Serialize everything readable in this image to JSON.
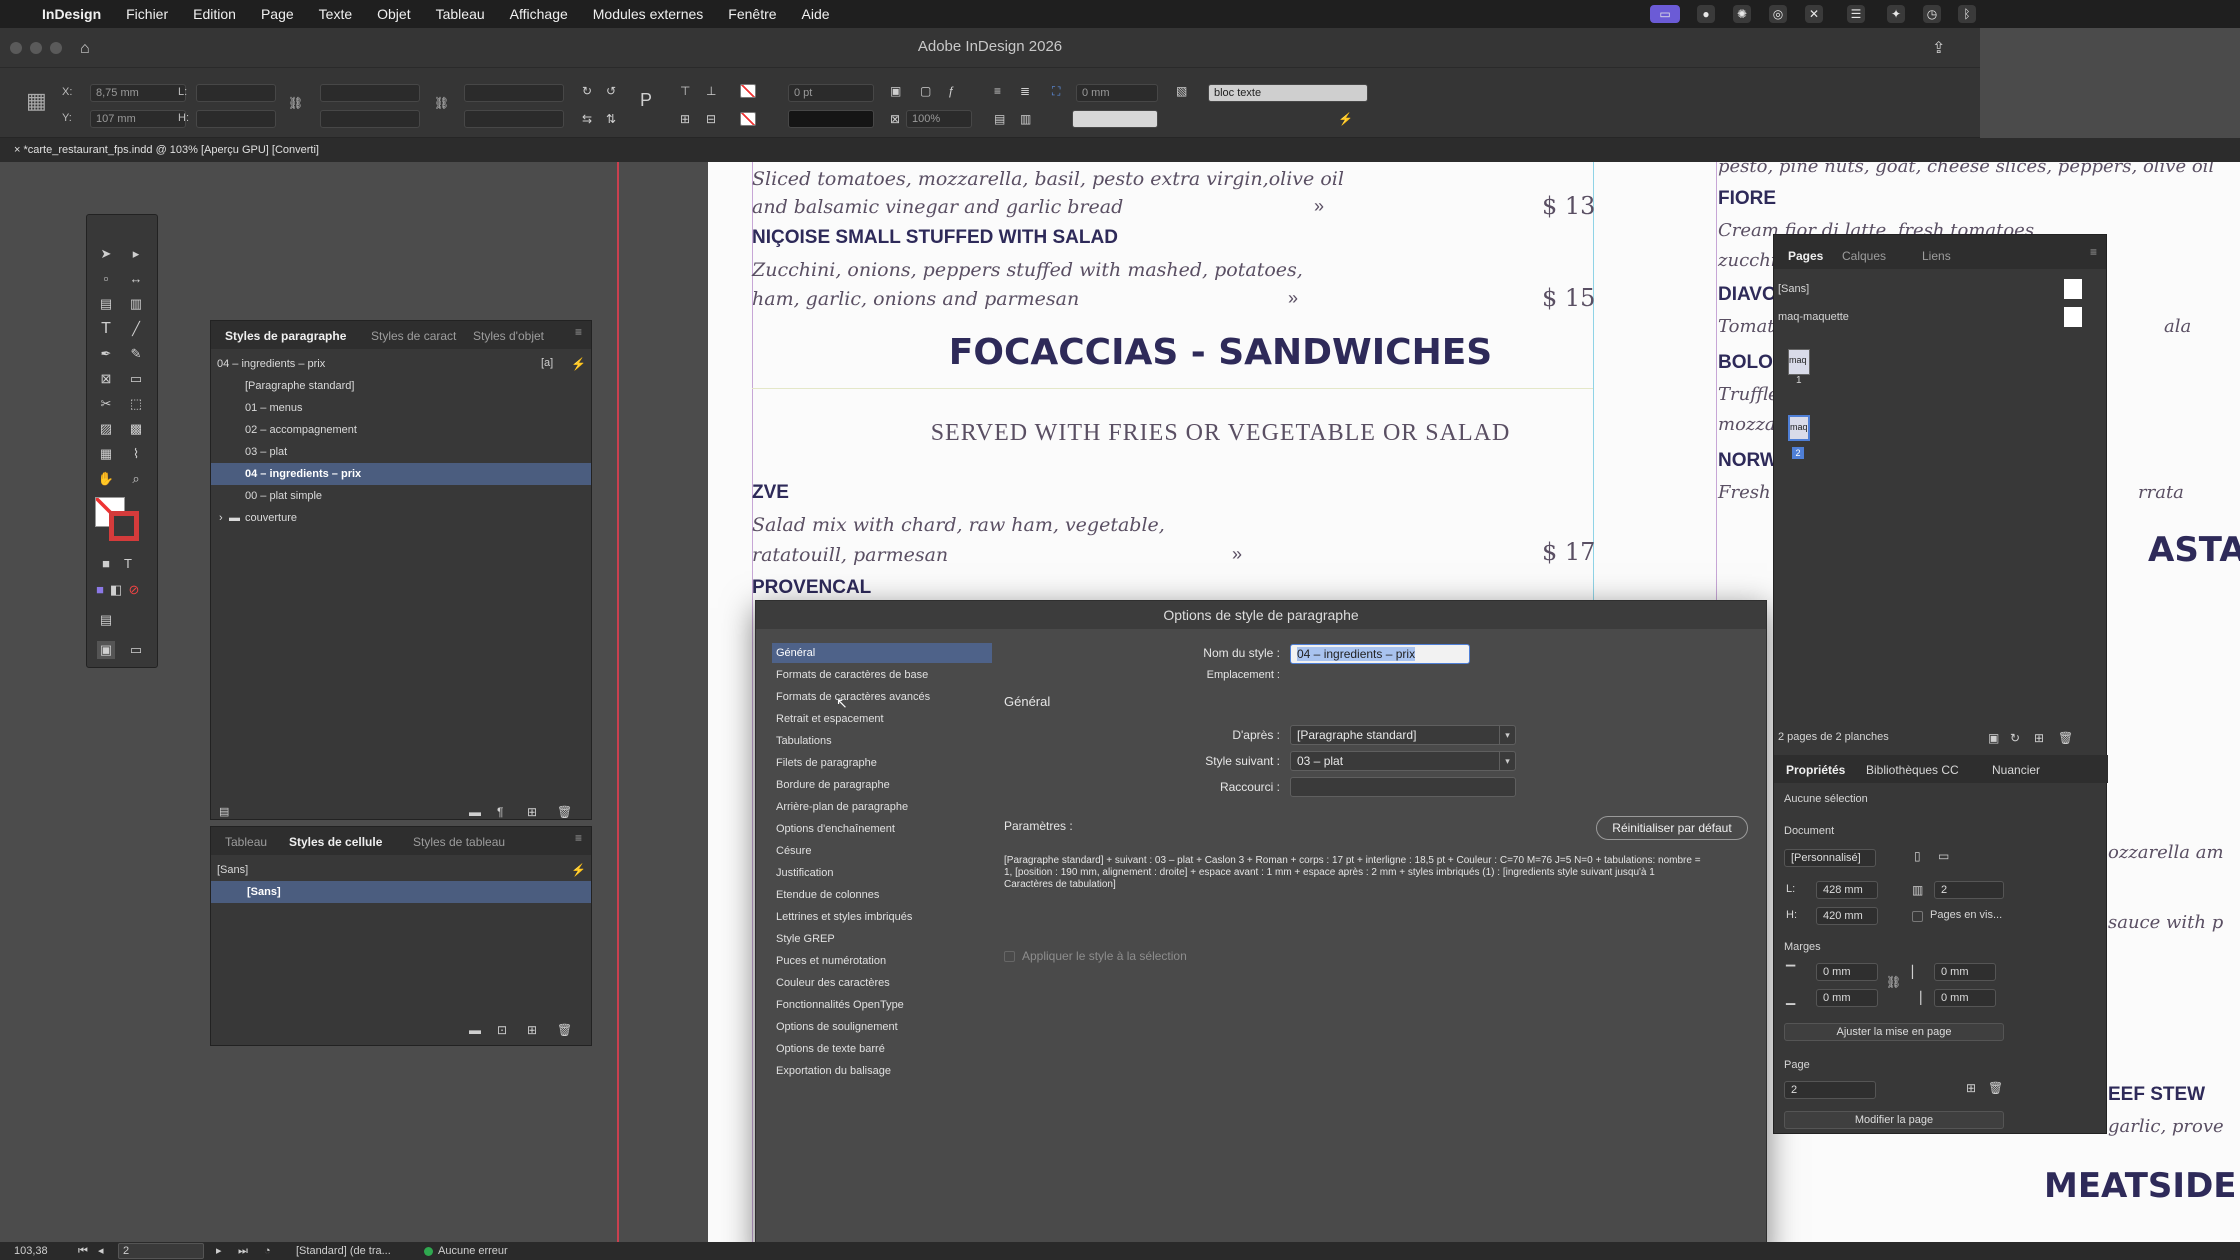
{
  "menubar": {
    "app": "InDesign",
    "items": [
      "Fichier",
      "Edition",
      "Page",
      "Texte",
      "Objet",
      "Tableau",
      "Affichage",
      "Modules externes",
      "Fenêtre",
      "Aide"
    ]
  },
  "window": {
    "title": "Adobe InDesign 2026",
    "doc_tab": "*carte_restaurant_fps.indd @ 103% [Aperçu GPU] [Converti]"
  },
  "control": {
    "x_label": "X:",
    "x_value": "8,75 mm",
    "y_label": "Y:",
    "y_value": "107 mm",
    "w_label": "L:",
    "h_label": "H:",
    "stroke_value": "0 pt",
    "scale_value": "100%",
    "offset_value": "0 mm",
    "object_style": "bloc texte"
  },
  "menu_page": {
    "line1": "Sliced tomatoes, mozzarella, basil, pesto extra virgin,olive oil",
    "line2": "and balsamic vinegar and garlic bread",
    "price1": "$ 13",
    "nicoise": "NIÇOISE SMALL STUFFED WITH SALAD",
    "line3": "Zucchini, onions, peppers stuffed with mashed, potatoes,",
    "line4": "ham, garlic, onions and parmesan",
    "price2": "$ 15",
    "section": "FOCACCIAS - SANDWICHES",
    "subsection": "SERVED WITH FRIES OR VEGETABLE OR SALAD",
    "zve": "ZVE",
    "line5": "Salad mix with chard, raw ham, vegetable,",
    "line6": "ratatouill, parmesan",
    "price3": "$ 17",
    "provencal": "PROVENCAL",
    "right_top": "pesto, pine nuts, goat, cheese slices, peppers, olive oil",
    "fiore": "FIORE",
    "fiore_desc": "Cream fior di latte, fresh tomatoes,",
    "zucchi": "zucchi",
    "diavo": "DIAVO",
    "tomat": "Tomat",
    "ala": "ala",
    "bolo": "BOLO",
    "truffle": "Truffle",
    "mozza": "mozza",
    "norw": "NORW",
    "fresh": "Fresh",
    "rrata": "rrata",
    "asta": "ASTA",
    "mozzarella_am": "ozzarella am",
    "sauce_with": "sauce with p",
    "eef_stew": "EEF STEW",
    "garlic_prove": "garlic, prove",
    "meatside": "MEATSIDE"
  },
  "para_styles_panel": {
    "tabs": [
      "Styles de paragraphe",
      "Styles de caract",
      "Styles d'objet"
    ],
    "current": "04 – ingredients – prix",
    "items": [
      "[Paragraphe standard]",
      "01 – menus",
      "02 – accompagnement",
      "03 – plat",
      "04 – ingredients – prix",
      "00 – plat simple",
      "couverture"
    ]
  },
  "cell_styles_panel": {
    "tabs": [
      "Tableau",
      "Styles de cellule",
      "Styles de tableau"
    ],
    "current": "[Sans]",
    "items": [
      "[Sans]"
    ]
  },
  "dialog": {
    "title": "Options de style de paragraphe",
    "categories": [
      "Général",
      "Formats de caractères de base",
      "Formats de caractères avancés",
      "Retrait et espacement",
      "Tabulations",
      "Filets de paragraphe",
      "Bordure de paragraphe",
      "Arrière-plan de paragraphe",
      "Options d'enchaînement",
      "Césure",
      "Justification",
      "Etendue de colonnes",
      "Lettrines et styles imbriqués",
      "Style GREP",
      "Puces et numérotation",
      "Couleur des caractères",
      "Fonctionnalités OpenType",
      "Options de soulignement",
      "Options de texte barré",
      "Exportation du balisage"
    ],
    "style_name_label": "Nom du style :",
    "style_name": "04 – ingredients – prix",
    "location_label": "Emplacement :",
    "section_title": "Général",
    "based_on_label": "D'après :",
    "based_on": "[Paragraphe standard]",
    "next_style_label": "Style suivant :",
    "next_style": "03 – plat",
    "shortcut_label": "Raccourci :",
    "params_label": "Paramètres :",
    "reset_button": "Réinitialiser par défaut",
    "params_text": "[Paragraphe standard] + suivant : 03 – plat + Caslon 3 + Roman + corps : 17 pt + interligne : 18,5 pt + Couleur : C=70 M=76 J=5 N=0 + tabulations: nombre = 1, [position : 190 mm, alignement : droite] + espace avant : 1 mm + espace après : 2 mm + styles imbriqués (1) : [ingredients style suivant jusqu'à 1 Caractères de tabulation]",
    "apply_label": "Appliquer le style à la sélection"
  },
  "pages_panel": {
    "tabs": [
      "Pages",
      "Calques",
      "Liens"
    ],
    "none_master": "[Sans]",
    "master": "maq-maquette",
    "page1_label": "maq",
    "page1_num": "1",
    "page2_label": "maq",
    "page2_num": "2",
    "footer": "2 pages de 2 planches"
  },
  "props_panel": {
    "tabs": [
      "Propriétés",
      "Bibliothèques CC",
      "Nuancier"
    ],
    "selection": "Aucune sélection",
    "document_label": "Document",
    "preset": "[Personnalisé]",
    "width_label": "L:",
    "width": "428 mm",
    "height_label": "H:",
    "height": "420 mm",
    "pages_count": "2",
    "facing_pages": "Pages en vis...",
    "margins_label": "Marges",
    "margin_top": "0 mm",
    "margin_bottom": "0 mm",
    "margin_left": "0 mm",
    "margin_right": "0 mm",
    "adjust_button": "Ajuster la mise en page",
    "page_label": "Page",
    "page_value": "2",
    "modify_button": "Modifier la page"
  },
  "status": {
    "zoom": "103,38",
    "page": "2",
    "preflight_profile": "[Standard] (de tra...",
    "errors": "Aucune erreur"
  },
  "colors": {
    "accent": "#4b5d7f",
    "menu_heading": "#2e2a59",
    "menu_text": "#5a4f63",
    "ok_green": "#2fa84f"
  }
}
